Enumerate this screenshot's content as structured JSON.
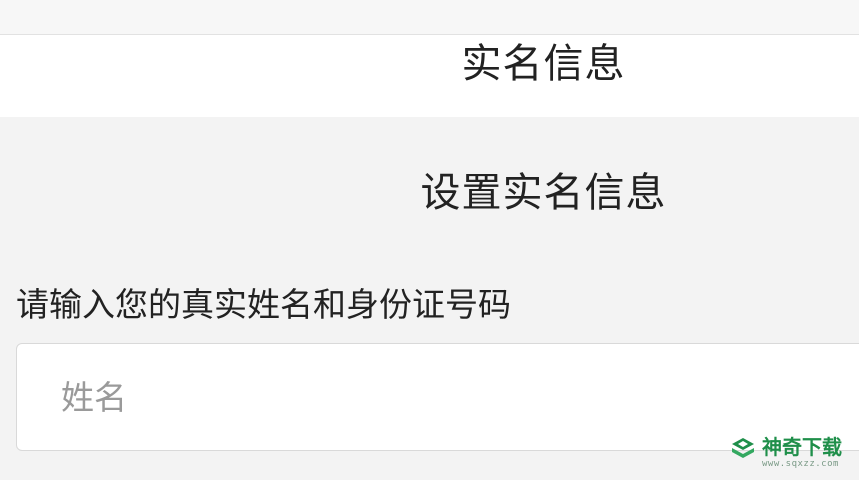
{
  "header": {
    "title": "实名信息"
  },
  "form": {
    "section_title": "设置实名信息",
    "hint": "请输入您的真实姓名和身份证号码",
    "name_input": {
      "value": "",
      "placeholder": "姓名"
    }
  },
  "watermark": {
    "brand": "神奇下载",
    "url": "www.sqxzz.com",
    "color": "#1f8f4a"
  }
}
